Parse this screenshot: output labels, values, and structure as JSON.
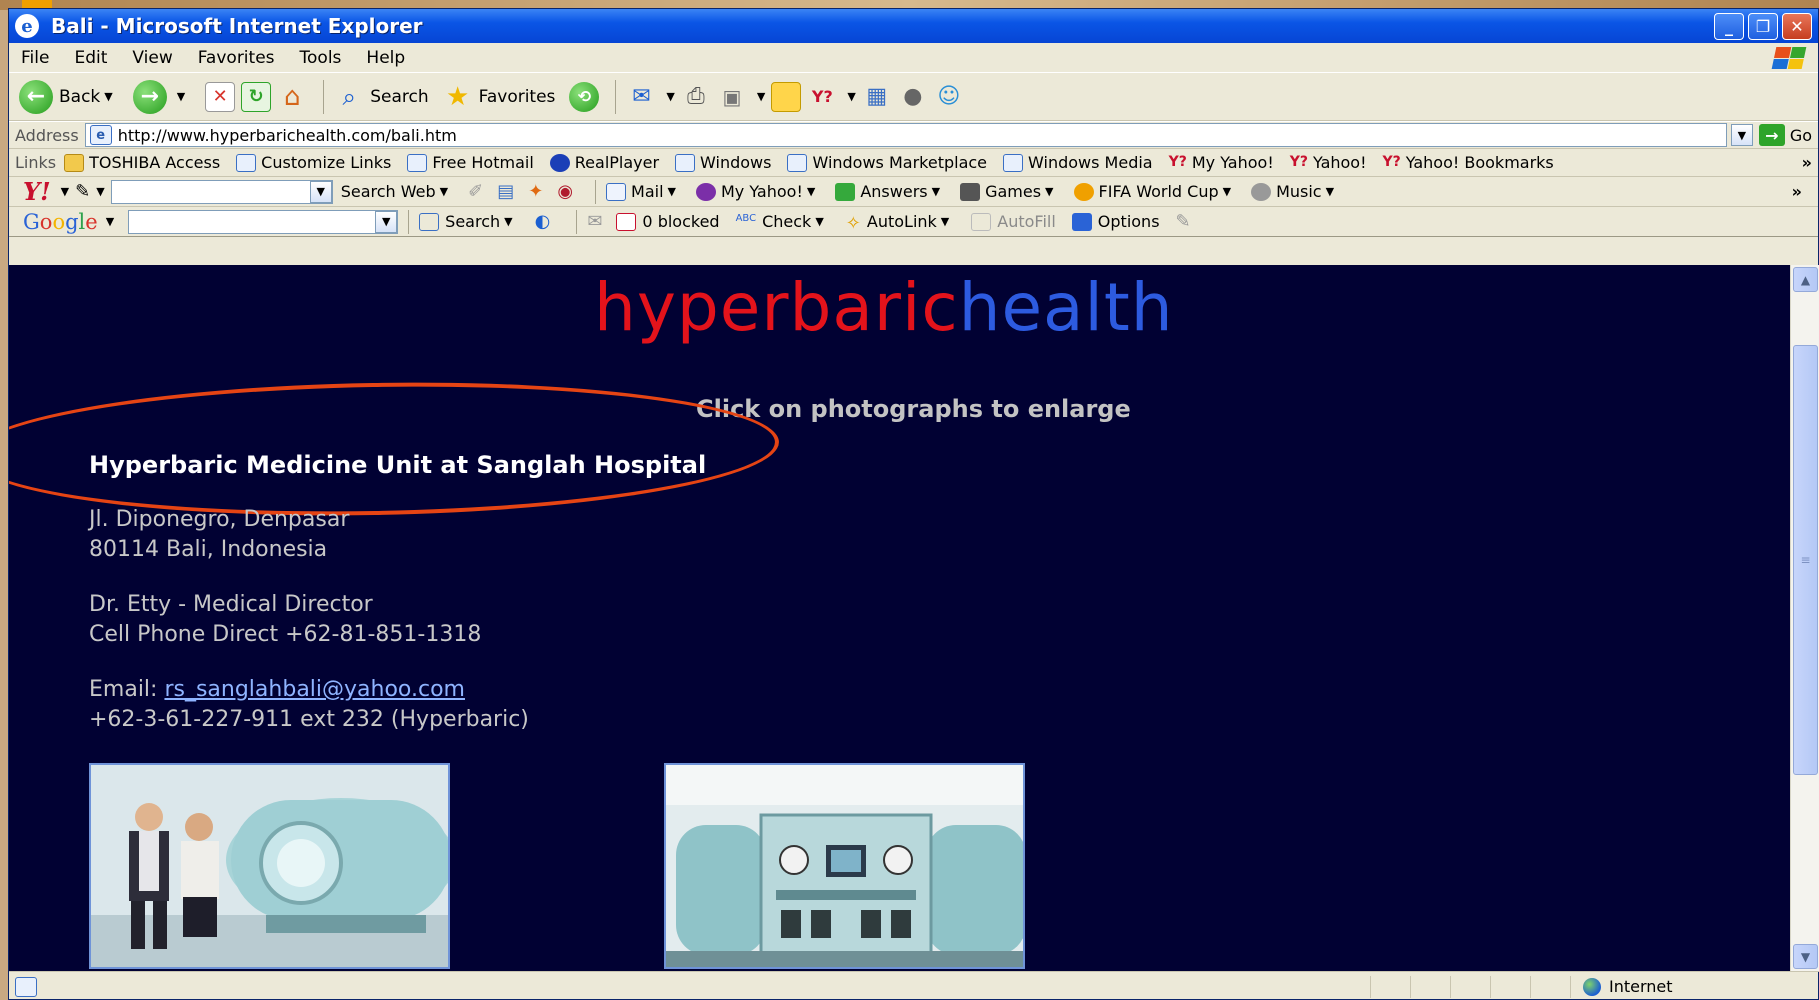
{
  "window": {
    "title": "Bali - Microsoft Internet Explorer",
    "min": "_",
    "max": "❐",
    "close": "✕"
  },
  "menu": [
    "File",
    "Edit",
    "View",
    "Favorites",
    "Tools",
    "Help"
  ],
  "toolbar": {
    "back": "Back",
    "search": "Search",
    "favorites": "Favorites"
  },
  "address": {
    "label": "Address",
    "url": "http://www.hyperbarichealth.com/bali.htm",
    "go": "Go"
  },
  "links": {
    "label": "Links",
    "items": [
      "TOSHIBA Access",
      "Customize Links",
      "Free Hotmail",
      "RealPlayer",
      "Windows",
      "Windows Marketplace",
      "Windows Media",
      "My Yahoo!",
      "Yahoo!",
      "Yahoo! Bookmarks"
    ],
    "more": "»"
  },
  "yahoo": {
    "logo": "Y!",
    "search_web": "Search Web",
    "mail": "Mail",
    "my_yahoo": "My Yahoo!",
    "answers": "Answers",
    "games": "Games",
    "fifa": "FIFA World Cup",
    "music": "Music",
    "more": "»"
  },
  "google": {
    "search": "Search",
    "blocked": "0 blocked",
    "check": "Check",
    "autolink": "AutoLink",
    "autofill": "AutoFill",
    "options": "Options"
  },
  "page": {
    "logo_red": "hyperbaric",
    "logo_blue": "health",
    "hint": "Click on photographs to enlarge",
    "heading": "Hyperbaric Medicine Unit at Sanglah Hospital",
    "address_line1": "Jl. Diponegro, Denpasar",
    "address_line2": "80114 Bali, Indonesia",
    "director": "Dr. Etty - Medical Director",
    "cell": "Cell Phone Direct +62-81-851-1318",
    "email_label": "Email: ",
    "email": "rs_sanglahbali@yahoo.com",
    "phone": "+62-3-61-227-911 ext 232 (Hyperbaric)"
  },
  "status": {
    "zone": "Internet"
  },
  "colors": {
    "page_bg": "#010133",
    "logo_red": "#e3131b",
    "logo_blue": "#2d5be0",
    "annotation": "#e54414"
  }
}
